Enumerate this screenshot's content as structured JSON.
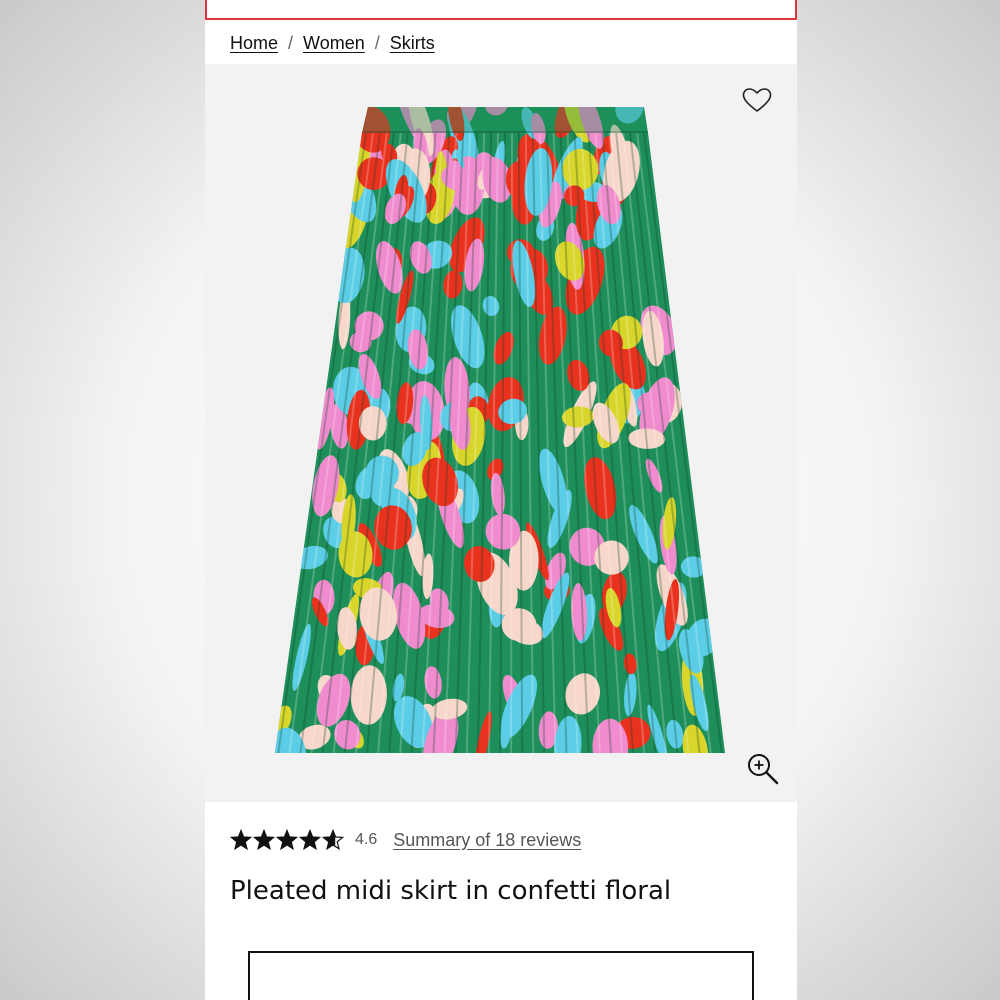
{
  "breadcrumb": {
    "items": [
      "Home",
      "Women",
      "Skirts"
    ],
    "separator": "/"
  },
  "product": {
    "title": "Pleated midi skirt in confetti floral",
    "rating_value": "4.6",
    "rating_stars": 4.6,
    "reviews_link": "Summary of 18 reviews",
    "image_alt": "Pleated midi skirt in confetti floral print"
  },
  "icons": {
    "favorite": "heart-icon",
    "zoom": "zoom-in-icon",
    "rating": "star-icon"
  },
  "colors": {
    "accent": "#d9363e",
    "text": "#111111",
    "muted": "#555555",
    "print_green": "#1e8f5a",
    "print_pink": "#f08ccd",
    "print_cyan": "#5ccde6",
    "print_red": "#e8321e",
    "print_blush": "#f7d7c9",
    "print_yellow": "#d8d62a"
  }
}
